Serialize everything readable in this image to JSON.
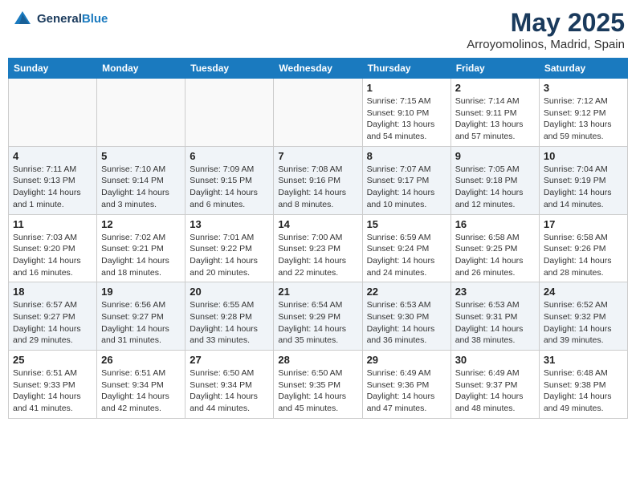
{
  "header": {
    "logo_line1": "General",
    "logo_line2": "Blue",
    "month_year": "May 2025",
    "location": "Arroyomolinos, Madrid, Spain"
  },
  "weekdays": [
    "Sunday",
    "Monday",
    "Tuesday",
    "Wednesday",
    "Thursday",
    "Friday",
    "Saturday"
  ],
  "weeks": [
    [
      {
        "day": "",
        "info": ""
      },
      {
        "day": "",
        "info": ""
      },
      {
        "day": "",
        "info": ""
      },
      {
        "day": "",
        "info": ""
      },
      {
        "day": "1",
        "info": "Sunrise: 7:15 AM\nSunset: 9:10 PM\nDaylight: 13 hours\nand 54 minutes."
      },
      {
        "day": "2",
        "info": "Sunrise: 7:14 AM\nSunset: 9:11 PM\nDaylight: 13 hours\nand 57 minutes."
      },
      {
        "day": "3",
        "info": "Sunrise: 7:12 AM\nSunset: 9:12 PM\nDaylight: 13 hours\nand 59 minutes."
      }
    ],
    [
      {
        "day": "4",
        "info": "Sunrise: 7:11 AM\nSunset: 9:13 PM\nDaylight: 14 hours\nand 1 minute."
      },
      {
        "day": "5",
        "info": "Sunrise: 7:10 AM\nSunset: 9:14 PM\nDaylight: 14 hours\nand 3 minutes."
      },
      {
        "day": "6",
        "info": "Sunrise: 7:09 AM\nSunset: 9:15 PM\nDaylight: 14 hours\nand 6 minutes."
      },
      {
        "day": "7",
        "info": "Sunrise: 7:08 AM\nSunset: 9:16 PM\nDaylight: 14 hours\nand 8 minutes."
      },
      {
        "day": "8",
        "info": "Sunrise: 7:07 AM\nSunset: 9:17 PM\nDaylight: 14 hours\nand 10 minutes."
      },
      {
        "day": "9",
        "info": "Sunrise: 7:05 AM\nSunset: 9:18 PM\nDaylight: 14 hours\nand 12 minutes."
      },
      {
        "day": "10",
        "info": "Sunrise: 7:04 AM\nSunset: 9:19 PM\nDaylight: 14 hours\nand 14 minutes."
      }
    ],
    [
      {
        "day": "11",
        "info": "Sunrise: 7:03 AM\nSunset: 9:20 PM\nDaylight: 14 hours\nand 16 minutes."
      },
      {
        "day": "12",
        "info": "Sunrise: 7:02 AM\nSunset: 9:21 PM\nDaylight: 14 hours\nand 18 minutes."
      },
      {
        "day": "13",
        "info": "Sunrise: 7:01 AM\nSunset: 9:22 PM\nDaylight: 14 hours\nand 20 minutes."
      },
      {
        "day": "14",
        "info": "Sunrise: 7:00 AM\nSunset: 9:23 PM\nDaylight: 14 hours\nand 22 minutes."
      },
      {
        "day": "15",
        "info": "Sunrise: 6:59 AM\nSunset: 9:24 PM\nDaylight: 14 hours\nand 24 minutes."
      },
      {
        "day": "16",
        "info": "Sunrise: 6:58 AM\nSunset: 9:25 PM\nDaylight: 14 hours\nand 26 minutes."
      },
      {
        "day": "17",
        "info": "Sunrise: 6:58 AM\nSunset: 9:26 PM\nDaylight: 14 hours\nand 28 minutes."
      }
    ],
    [
      {
        "day": "18",
        "info": "Sunrise: 6:57 AM\nSunset: 9:27 PM\nDaylight: 14 hours\nand 29 minutes."
      },
      {
        "day": "19",
        "info": "Sunrise: 6:56 AM\nSunset: 9:27 PM\nDaylight: 14 hours\nand 31 minutes."
      },
      {
        "day": "20",
        "info": "Sunrise: 6:55 AM\nSunset: 9:28 PM\nDaylight: 14 hours\nand 33 minutes."
      },
      {
        "day": "21",
        "info": "Sunrise: 6:54 AM\nSunset: 9:29 PM\nDaylight: 14 hours\nand 35 minutes."
      },
      {
        "day": "22",
        "info": "Sunrise: 6:53 AM\nSunset: 9:30 PM\nDaylight: 14 hours\nand 36 minutes."
      },
      {
        "day": "23",
        "info": "Sunrise: 6:53 AM\nSunset: 9:31 PM\nDaylight: 14 hours\nand 38 minutes."
      },
      {
        "day": "24",
        "info": "Sunrise: 6:52 AM\nSunset: 9:32 PM\nDaylight: 14 hours\nand 39 minutes."
      }
    ],
    [
      {
        "day": "25",
        "info": "Sunrise: 6:51 AM\nSunset: 9:33 PM\nDaylight: 14 hours\nand 41 minutes."
      },
      {
        "day": "26",
        "info": "Sunrise: 6:51 AM\nSunset: 9:34 PM\nDaylight: 14 hours\nand 42 minutes."
      },
      {
        "day": "27",
        "info": "Sunrise: 6:50 AM\nSunset: 9:34 PM\nDaylight: 14 hours\nand 44 minutes."
      },
      {
        "day": "28",
        "info": "Sunrise: 6:50 AM\nSunset: 9:35 PM\nDaylight: 14 hours\nand 45 minutes."
      },
      {
        "day": "29",
        "info": "Sunrise: 6:49 AM\nSunset: 9:36 PM\nDaylight: 14 hours\nand 47 minutes."
      },
      {
        "day": "30",
        "info": "Sunrise: 6:49 AM\nSunset: 9:37 PM\nDaylight: 14 hours\nand 48 minutes."
      },
      {
        "day": "31",
        "info": "Sunrise: 6:48 AM\nSunset: 9:38 PM\nDaylight: 14 hours\nand 49 minutes."
      }
    ]
  ]
}
